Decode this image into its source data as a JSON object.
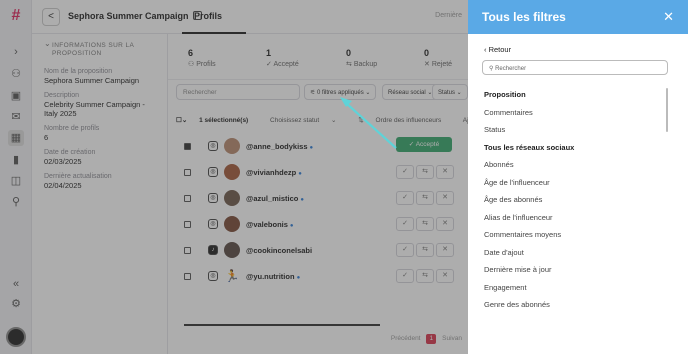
{
  "rail": {
    "icons": [
      "logo-icon",
      "expand-icon",
      "users-icon",
      "inbox-icon",
      "mail-icon",
      "calendar-icon",
      "chart-icon",
      "report-icon",
      "settings-flow-icon",
      "collapse-icon",
      "gear-icon"
    ],
    "logo_glyph": "#"
  },
  "topbar": {
    "back_glyph": "<",
    "campaign_title": "Sephora Summer Campaign",
    "tab_profils": "Profils",
    "right_text": "Dernière"
  },
  "info": {
    "section_title": "INFORMATIONS SUR LA PROPOSITION",
    "fields": [
      {
        "label": "Nom de la proposition",
        "value": "Sephora Summer Campaign"
      },
      {
        "label": "Description",
        "value": "Celebrity Summer Campaign - Italy 2025"
      },
      {
        "label": "Nombre de profils",
        "value": "6"
      },
      {
        "label": "Date de création",
        "value": "02/03/2025"
      },
      {
        "label": "Dernière actualisation",
        "value": "02/04/2025"
      }
    ]
  },
  "main": {
    "stats": [
      {
        "num": "6",
        "label": "Profils",
        "icon": "users-icon"
      },
      {
        "num": "1",
        "label": "Accepté",
        "icon": "check-icon"
      },
      {
        "num": "0",
        "label": "Backup",
        "icon": "swap-icon"
      },
      {
        "num": "0",
        "label": "Rejeté",
        "icon": "close-icon"
      }
    ],
    "search_placeholder": "Rechercher",
    "filters_applied": "0 filtres appliqués",
    "network_filter": "Réseau social",
    "status_filter": "Status",
    "bulk": {
      "selected": "1 sélectionné(s)",
      "status": "Choisissez statut",
      "order": "Ordre des influenceurs",
      "add": "Ajouter",
      "extra": "En"
    },
    "rows": [
      {
        "handle": "@anne_bodykiss",
        "platform": "instagram",
        "checked": true,
        "accepted": true
      },
      {
        "handle": "@vivianhdezp",
        "platform": "instagram",
        "checked": false,
        "accepted": false
      },
      {
        "handle": "@azul_mistico",
        "platform": "instagram",
        "checked": false,
        "accepted": false
      },
      {
        "handle": "@valebonis",
        "platform": "instagram",
        "checked": false,
        "accepted": false
      },
      {
        "handle": "@cookinconelsabi",
        "platform": "tiktok",
        "checked": false,
        "accepted": false
      },
      {
        "handle": "@yu.nutrition",
        "platform": "instagram",
        "checked": false,
        "accepted": false
      }
    ],
    "accepted_label": "Accepté",
    "pager": {
      "prev": "Précédent",
      "page": "1",
      "next": "Suivan"
    }
  },
  "drawer": {
    "title": "Tous les filtres",
    "close_glyph": "✕",
    "back": "Retour",
    "search_placeholder": "Rechercher",
    "items": [
      {
        "label": "Proposition",
        "bold": true
      },
      {
        "label": "Commentaires",
        "bold": false
      },
      {
        "label": "Status",
        "bold": false
      },
      {
        "label": "Tous les réseaux sociaux",
        "bold": true
      },
      {
        "label": "Abonnés",
        "bold": false
      },
      {
        "label": "Âge de l'influenceur",
        "bold": false
      },
      {
        "label": "Âge des abonnés",
        "bold": false
      },
      {
        "label": "Alias de l'influenceur",
        "bold": false
      },
      {
        "label": "Commentaires moyens",
        "bold": false
      },
      {
        "label": "Date d'ajout",
        "bold": false
      },
      {
        "label": "Dernière mise à jour",
        "bold": false
      },
      {
        "label": "Engagement",
        "bold": false
      },
      {
        "label": "Genre des abonnés",
        "bold": false
      }
    ]
  },
  "colors": {
    "drawer_header": "#5aa9e6",
    "accepted": "#35a86b",
    "annotation_arrow": "#5fd3d8",
    "page_active": "#d9364f"
  }
}
